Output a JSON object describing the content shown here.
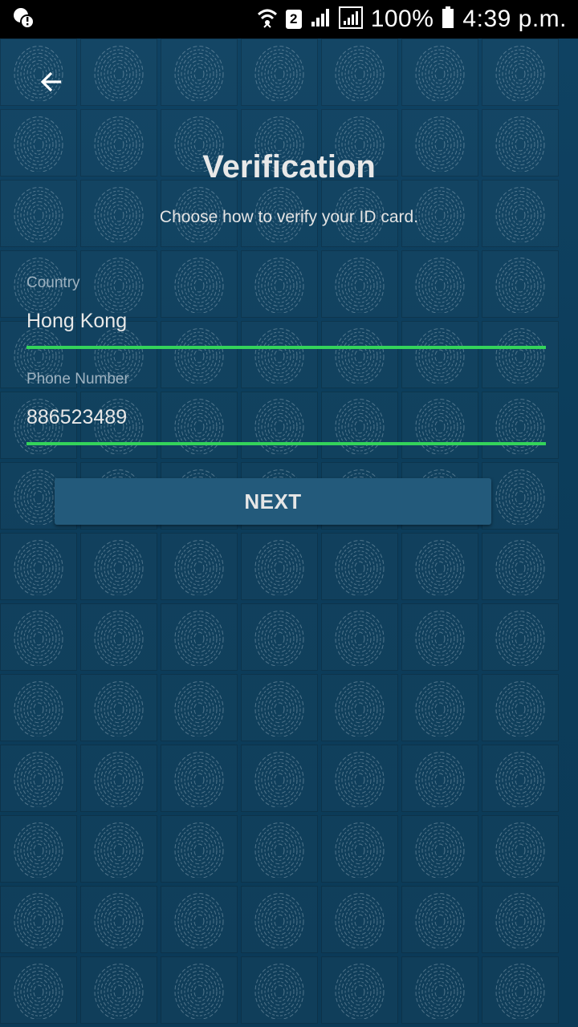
{
  "status_bar": {
    "battery": "100%",
    "time": "4:39 p.m.",
    "sim_slot": "2"
  },
  "header": {
    "back_icon": "arrow-left-icon"
  },
  "main": {
    "title": "Verification",
    "subtitle": "Choose how to verify your ID card.",
    "country": {
      "label": "Country",
      "value": "Hong Kong"
    },
    "phone": {
      "label": "Phone Number",
      "value": "886523489"
    },
    "next_label": "NEXT"
  },
  "colors": {
    "background": "#0d3c58",
    "accent_underline": "#34d35a",
    "button": "#235a7b"
  }
}
